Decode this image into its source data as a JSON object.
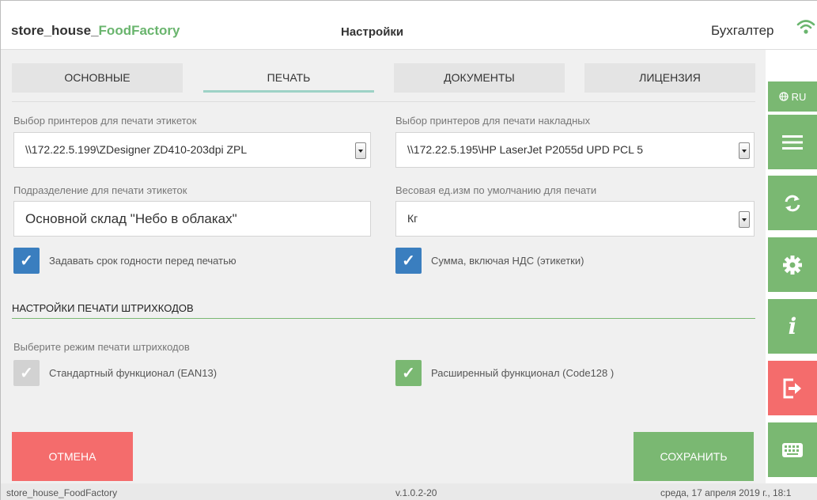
{
  "header": {
    "app_title_prefix": "store_house_",
    "app_title_accent": "FoodFactory",
    "page_title": "Настройки",
    "user": "Бухгалтер"
  },
  "tabs": [
    {
      "label": "ОСНОВНЫЕ",
      "active": false
    },
    {
      "label": "ПЕЧАТЬ",
      "active": true
    },
    {
      "label": "ДОКУМЕНТЫ",
      "active": false
    },
    {
      "label": "ЛИЦЕНЗИЯ",
      "active": false
    }
  ],
  "form": {
    "label_printer_labels": "Выбор принтеров для печати этикеток",
    "printer_labels_value": "\\\\172.22.5.199\\ZDesigner ZD410-203dpi ZPL",
    "label_printer_invoices": "Выбор принтеров для печати накладных",
    "printer_invoices_value": "\\\\172.22.5.195\\HP LaserJet P2055d UPD PCL 5",
    "label_department": "Подразделение для печати этикеток",
    "department_value": "Основной склад \"Небо в облаках\"",
    "label_weight_unit": "Весовая ед.изм по умолчанию для печати",
    "weight_unit_value": "Кг",
    "cb_expiry_label": "Задавать срок годности перед печатью",
    "cb_vat_label": "Сумма, включая НДС (этикетки)"
  },
  "barcode": {
    "section_title": "НАСТРОЙКИ ПЕЧАТИ ШТРИХКОДОВ",
    "mode_label": "Выберите режим печати штрихкодов",
    "standard_label": "Стандартный функционал (EAN13)",
    "extended_label": "Расширенный функционал (Code128 )"
  },
  "buttons": {
    "cancel": "ОТМЕНА",
    "save": "СОХРАНИТЬ"
  },
  "sidebar": {
    "lang": "RU",
    "icons": [
      "menu-icon",
      "sync-icon",
      "gear-icon",
      "info-icon",
      "logout-icon",
      "keyboard-icon"
    ]
  },
  "footer": {
    "app": "store_house_FoodFactory",
    "version": "v.1.0.2-20",
    "datetime": "среда, 17 апреля 2019 г., 18:1"
  },
  "colors": {
    "accent_green": "#7ab872",
    "danger_red": "#f46c6c",
    "checkbox_blue": "#3a7ebf"
  }
}
